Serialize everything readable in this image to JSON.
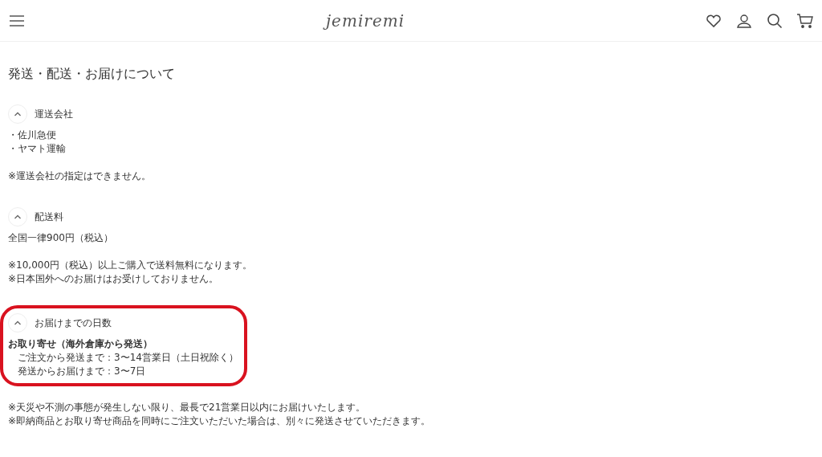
{
  "header": {
    "logo": "jemiremi"
  },
  "title": "発送・配送・お届けについて",
  "sections": [
    {
      "heading": "運送会社",
      "expanded": true,
      "highlighted": false,
      "blocks": [
        {
          "lines": [
            {
              "kind": "plain",
              "text": "・佐川急便"
            },
            {
              "kind": "plain",
              "text": "・ヤマト運輸"
            }
          ]
        },
        {
          "lines": [
            {
              "kind": "plain",
              "text": "※運送会社の指定はできません。"
            }
          ]
        }
      ]
    },
    {
      "heading": "配送料",
      "expanded": true,
      "highlighted": false,
      "blocks": [
        {
          "lines": [
            {
              "kind": "plain",
              "text": "全国一律900円（税込）"
            }
          ]
        },
        {
          "lines": [
            {
              "kind": "plain",
              "text": "※10,000円（税込）以上ご購入で送料無料になります。"
            },
            {
              "kind": "plain",
              "text": "※日本国外へのお届けはお受けしておりません。"
            }
          ]
        }
      ]
    },
    {
      "heading": "お届けまでの日数",
      "expanded": true,
      "highlighted": true,
      "blocks": [
        {
          "lines": [
            {
              "kind": "bold",
              "text": "お取り寄せ（海外倉庫から発送）"
            },
            {
              "kind": "indent",
              "text": "ご注文から発送まで：3〜14営業日（土日祝除く）"
            },
            {
              "kind": "indent",
              "text": "発送からお届けまで：3〜7日"
            }
          ]
        }
      ]
    }
  ],
  "notes": [
    "※天災や不測の事態が発生しない限り、最長で21営業日以内にお届けいたします。",
    "※即納商品とお取り寄せ商品を同時にご注文いただいた場合は、別々に発送させていただきます。"
  ]
}
